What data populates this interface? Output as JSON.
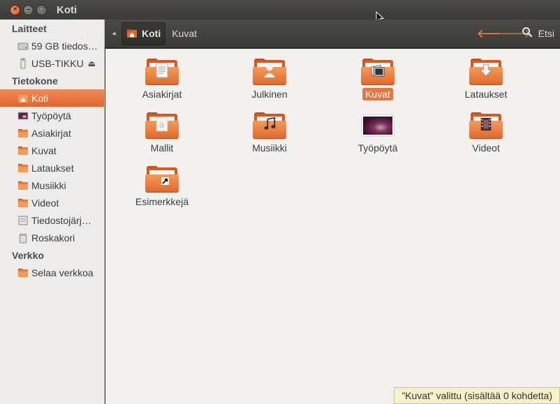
{
  "window": {
    "title": "Koti"
  },
  "sidebar": {
    "sections": [
      {
        "heading": "Laitteet",
        "items": [
          {
            "label": "59 GB tiedos…",
            "icon": "hard-drive-icon"
          },
          {
            "label": "USB-TIKKU",
            "icon": "usb-drive-icon",
            "eject": "⏏"
          }
        ]
      },
      {
        "heading": "Tietokone",
        "items": [
          {
            "label": "Koti",
            "icon": "home-folder-icon",
            "selected": true
          },
          {
            "label": "Työpöytä",
            "icon": "desktop-icon"
          },
          {
            "label": "Asiakirjat",
            "icon": "documents-folder-icon"
          },
          {
            "label": "Kuvat",
            "icon": "pictures-folder-icon"
          },
          {
            "label": "Lataukset",
            "icon": "downloads-folder-icon"
          },
          {
            "label": "Musiikki",
            "icon": "music-folder-icon"
          },
          {
            "label": "Videot",
            "icon": "videos-folder-icon"
          },
          {
            "label": "Tiedostojärj…",
            "icon": "filesystem-icon"
          },
          {
            "label": "Roskakori",
            "icon": "trash-icon"
          }
        ]
      },
      {
        "heading": "Verkko",
        "items": [
          {
            "label": "Selaa verkkoa",
            "icon": "network-icon"
          }
        ]
      }
    ]
  },
  "toolbar": {
    "back_small": "◂",
    "breadcrumb_home": "Koti",
    "breadcrumb_next": "Kuvat",
    "search_label": "Etsi"
  },
  "files": [
    {
      "label": "Asiakirjat",
      "icon": "documents-folder-icon",
      "emblem": "doc"
    },
    {
      "label": "Julkinen",
      "icon": "public-folder-icon",
      "emblem": "person"
    },
    {
      "label": "Kuvat",
      "icon": "pictures-folder-icon",
      "emblem": "picture",
      "selected": true
    },
    {
      "label": "Lataukset",
      "icon": "downloads-folder-icon",
      "emblem": "down"
    },
    {
      "label": "Mallit",
      "icon": "templates-folder-icon",
      "emblem": "template"
    },
    {
      "label": "Musiikki",
      "icon": "music-folder-icon",
      "emblem": "note"
    },
    {
      "label": "Työpöytä",
      "icon": "desktop-folder-icon",
      "emblem": "desktop"
    },
    {
      "label": "Videot",
      "icon": "videos-folder-icon",
      "emblem": "film"
    },
    {
      "label": "Esimerkkejä",
      "icon": "examples-link-folder-icon",
      "emblem": "link"
    }
  ],
  "status": {
    "text": "”Kuvat” valittu (sisältää 0 kohdetta)"
  },
  "colors": {
    "accent": "#e67540",
    "titlebar": "#3c3b37",
    "sidebar": "#edeceb",
    "content": "#f2f1f0"
  }
}
